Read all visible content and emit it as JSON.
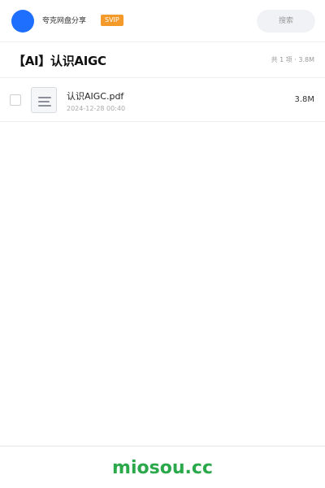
{
  "header": {
    "app_name": "夸克网盘分享",
    "badge": "SVIP",
    "search_label": "搜索"
  },
  "share": {
    "title": "【AI】认识AIGC",
    "summary": "共 1 项 · 3.8M"
  },
  "files": [
    {
      "name": "认识AIGC.pdf",
      "date": "2024-12-28 00:40",
      "size": "3.8M",
      "icon": "document-icon"
    }
  ],
  "footer": {
    "brand": "miosou.cc"
  },
  "colors": {
    "avatar": "#1f6fff",
    "badge": "#f39a2b",
    "brand": "#2aa84a"
  }
}
